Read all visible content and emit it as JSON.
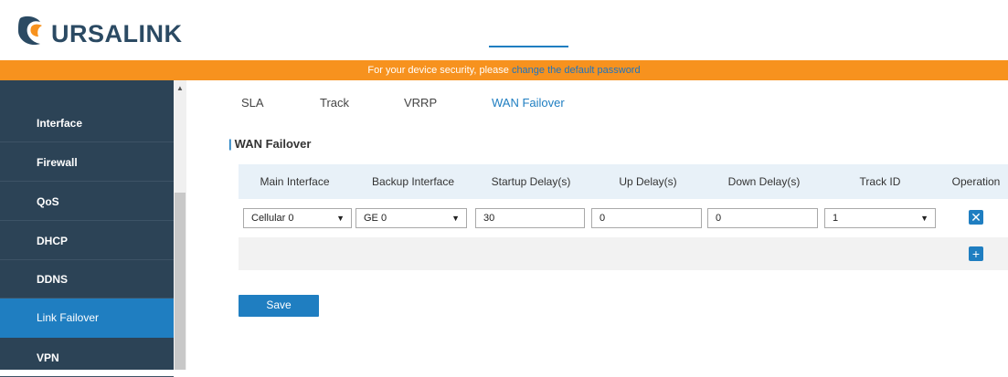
{
  "header": {
    "logo_text": "URSALINK",
    "notice_text": "For your device security, please ",
    "notice_link": "change the default password"
  },
  "sidebar": {
    "items": [
      {
        "label": "Interface"
      },
      {
        "label": "Firewall"
      },
      {
        "label": "QoS"
      },
      {
        "label": "DHCP"
      },
      {
        "label": "DDNS"
      },
      {
        "label": "Link Failover",
        "active": true
      },
      {
        "label": "VPN"
      }
    ]
  },
  "tabs": [
    {
      "label": "SLA"
    },
    {
      "label": "Track"
    },
    {
      "label": "VRRP"
    },
    {
      "label": "WAN Failover",
      "active": true
    }
  ],
  "section": {
    "bar": "|",
    "title": "WAN Failover"
  },
  "table": {
    "columns": [
      "Main Interface",
      "Backup Interface",
      "Startup Delay(s)",
      "Up Delay(s)",
      "Down Delay(s)",
      "Track ID",
      "Operation"
    ],
    "rows": [
      {
        "main_interface": "Cellular 0",
        "backup_interface": "GE 0",
        "startup_delay": "30",
        "up_delay": "0",
        "down_delay": "0",
        "track_id": "1"
      }
    ]
  },
  "buttons": {
    "save_label": "Save",
    "delete_icon": "close-icon",
    "add_icon": "plus-icon"
  },
  "colors": {
    "accent": "#1f7ec1",
    "notice_bg": "#f7921e",
    "sidebar_bg": "#2c4356"
  }
}
